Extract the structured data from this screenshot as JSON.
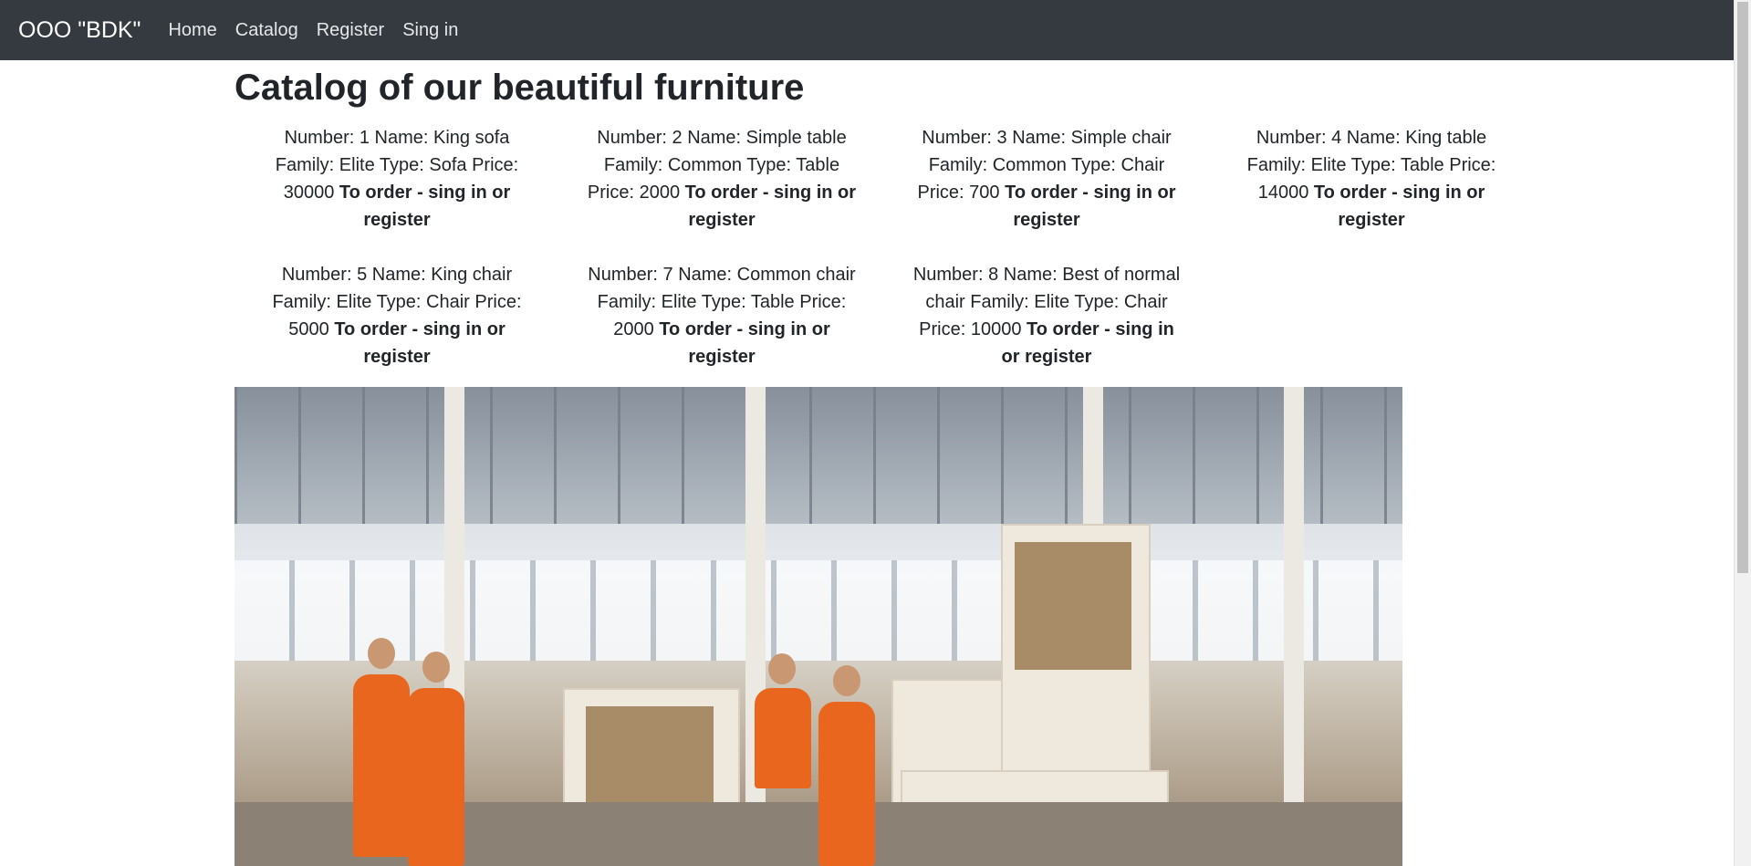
{
  "navbar": {
    "brand": "OOO \"BDK\"",
    "links": [
      "Home",
      "Catalog",
      "Register",
      "Sing in"
    ]
  },
  "page": {
    "title": "Catalog of our beautiful furniture"
  },
  "catalog": {
    "items": [
      {
        "text": "Number: 1 Name: King sofa Family: Elite Type: Sofa Price: 30000",
        "order": "To order - sing in or register"
      },
      {
        "text": "Number: 2 Name: Simple table Family: Common Type: Table Price: 2000",
        "order": "To order - sing in or register"
      },
      {
        "text": "Number: 3 Name: Simple chair Family: Common Type: Chair Price: 700",
        "order": "To order - sing in or register"
      },
      {
        "text": "Number: 4 Name: King table Family: Elite Type: Table Price: 14000",
        "order": "To order - sing in or register"
      },
      {
        "text": "Number: 5 Name: King chair Family: Elite Type: Chair Price: 5000",
        "order": "To order - sing in or register"
      },
      {
        "text": "Number: 7 Name: Common chair Family: Elite Type: Table Price: 2000",
        "order": "To order - sing in or register"
      },
      {
        "text": "Number: 8 Name: Best of normal chair Family: Elite Type: Chair Price: 10000",
        "order": "To order - sing in or register"
      }
    ]
  },
  "colors": {
    "navbar_bg": "#343a40",
    "text": "#212529",
    "worker_uniform": "#e8661e"
  }
}
